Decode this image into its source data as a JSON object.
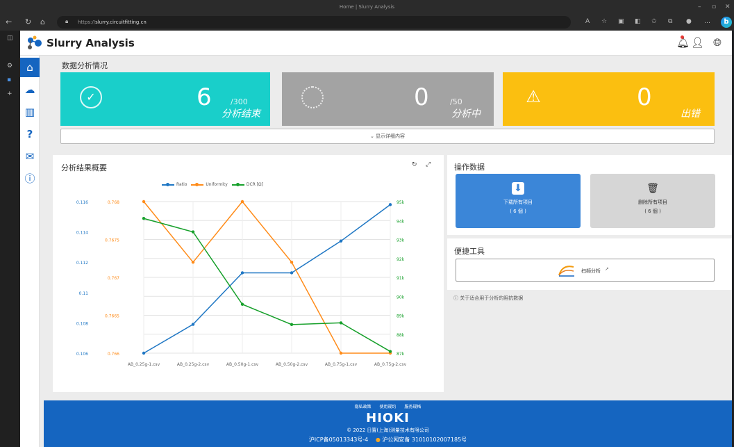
{
  "browser": {
    "window_title": "Home | Slurry Analysis",
    "url_prefix": "https://",
    "url_host": "slurry.circuitfitting.cn"
  },
  "app": {
    "name": "Slurry Analysis"
  },
  "section_title": "数据分析情况",
  "cards": [
    {
      "value": "6",
      "total": "/300",
      "label": "分析结束",
      "color": "#19cfca",
      "icon": "check-circle-icon"
    },
    {
      "value": "0",
      "total": "/50",
      "label": "分析中",
      "color": "#a3a3a3",
      "icon": "spinner-icon"
    },
    {
      "value": "0",
      "total": "",
      "label": "出错",
      "color": "#fbbf10",
      "icon": "warning-icon"
    }
  ],
  "detail_toggle": "显示详细内容",
  "chart_panel": {
    "title": "分析结果概要"
  },
  "chart_data": {
    "type": "line",
    "categories": [
      "AB_0.25g-1.csv",
      "AB_0.25g-2.csv",
      "AB_0.50g-1.csv",
      "AB_0.50g-2.csv",
      "AB_0.75g-1.csv",
      "AB_0.75g-2.csv"
    ],
    "series": [
      {
        "name": "Ratio",
        "color": "#1f77c4",
        "values": [
          0.106,
          0.1079,
          0.1113,
          0.1113,
          0.1134,
          0.1158
        ],
        "axis": "left1",
        "ylim": [
          0.106,
          0.116
        ]
      },
      {
        "name": "Uniformity",
        "color": "#ff8c1a",
        "values": [
          0.768,
          0.7672,
          0.768,
          0.7672,
          0.766,
          0.766
        ],
        "axis": "left2",
        "ylim": [
          0.766,
          0.768
        ]
      },
      {
        "name": "DCR [Ω]",
        "color": "#17a02b",
        "values": [
          94500,
          93700,
          89400,
          88200,
          88300,
          86600
        ],
        "axis": "right",
        "ylim": [
          86500,
          95500
        ]
      }
    ],
    "axis_left1_ticks": [
      "0.116",
      "0.114",
      "0.112",
      "0.11",
      "0.108",
      "0.106"
    ],
    "axis_left2_ticks": [
      "0.768",
      "0.7675",
      "0.767",
      "0.7665",
      "0.766"
    ],
    "axis_right_ticks": [
      "95k",
      "94k",
      "93k",
      "92k",
      "91k",
      "90k",
      "89k",
      "88k",
      "87k"
    ],
    "grid": true,
    "legend": "top"
  },
  "ops_panel": {
    "title": "操作数据",
    "download": {
      "line1": "下载所有项目",
      "line2": "( 6 個 )",
      "color": "#3b86d8"
    },
    "delete": {
      "line1": "删除所有项目",
      "line2": "( 6 個 )",
      "color": "#d6d6d6"
    }
  },
  "tools_panel": {
    "title": "便捷工具",
    "analysis_label": "扫频分析"
  },
  "note": "关于适合用于分析的阻抗数据",
  "footer": {
    "links": [
      "隐私政策",
      "使用规约",
      "服务规格"
    ],
    "brand": "HIOKI",
    "copyright": "© 2022 日置(上海)测量技术有限公司",
    "icp": "沪ICP备05013343号-4",
    "police": "沪公网安备 31010102007185号"
  }
}
